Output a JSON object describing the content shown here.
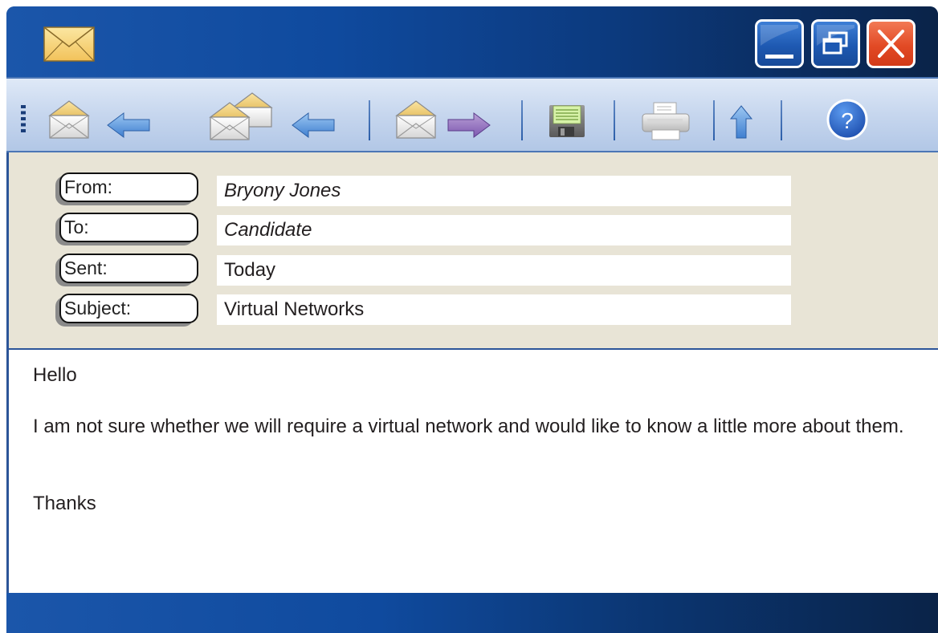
{
  "window": {
    "app_icon": "envelope-icon",
    "controls": {
      "minimize_icon": "minimize-icon",
      "maximize_icon": "restore-icon",
      "close_icon": "close-icon"
    }
  },
  "toolbar": {
    "items": [
      {
        "name": "reply-button",
        "icon": "reply-icon"
      },
      {
        "name": "reply-all-button",
        "icon": "reply-all-icon"
      },
      {
        "name": "forward-button",
        "icon": "forward-icon"
      },
      {
        "name": "save-button",
        "icon": "save-icon"
      },
      {
        "name": "print-button",
        "icon": "printer-icon"
      },
      {
        "name": "up-button",
        "icon": "up-arrow-icon"
      },
      {
        "name": "help-button",
        "icon": "help-icon",
        "glyph": "?"
      }
    ]
  },
  "header": {
    "from_label": "From:",
    "from_value": "Bryony Jones",
    "to_label": "To:",
    "to_value": "Candidate",
    "sent_label": "Sent:",
    "sent_value": "Today",
    "subject_label": "Subject:",
    "subject_value": "Virtual Networks"
  },
  "message": {
    "greeting": "Hello",
    "paragraph": "I am not sure whether we will require a virtual network and would like to know a little more about them.",
    "signoff": "Thanks"
  },
  "colors": {
    "titlebar": "#0f4a9e",
    "toolbar": "#c6d6ee",
    "header_bg": "#e8e4d6",
    "close_button": "#e24a25",
    "help_button": "#2563c4"
  }
}
